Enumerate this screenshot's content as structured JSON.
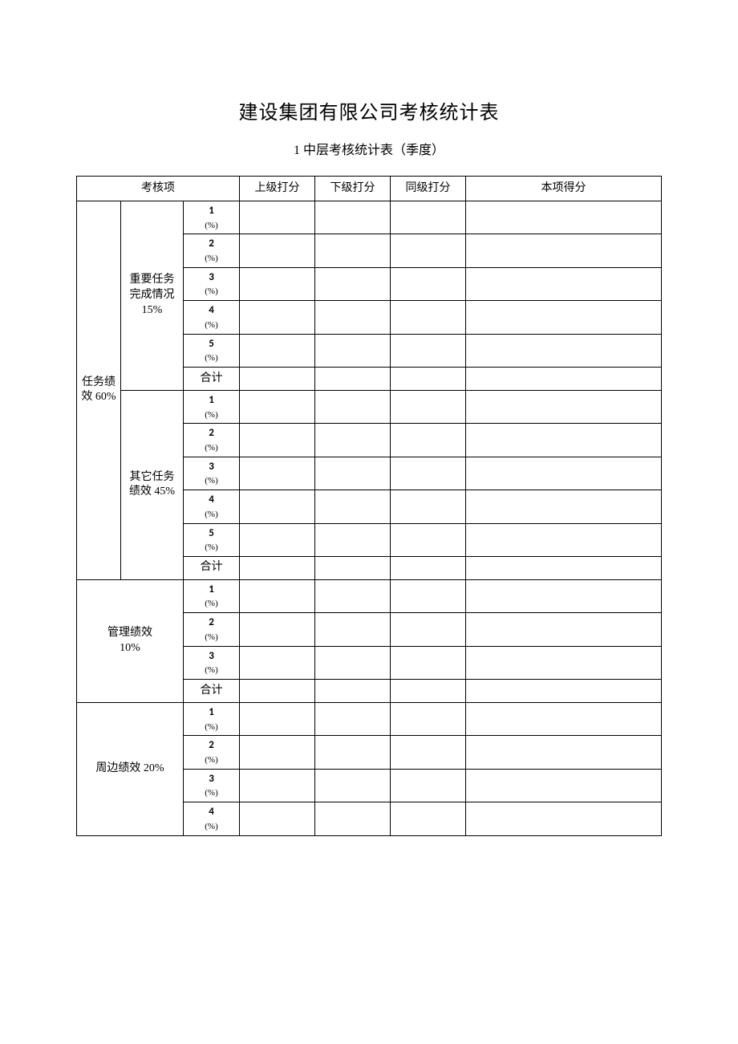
{
  "title": "建设集团有限公司考核统计表",
  "subtitle": "1 中层考核统计表（季度）",
  "headers": {
    "item": "考核项",
    "superior": "上级打分",
    "subordinate": "下级打分",
    "peer": "同级打分",
    "score": "本项得分"
  },
  "labels": {
    "task_perf": "任务绩\n效 60%",
    "important_task": "重要任务\n完成情况\n15%",
    "other_task": "其它任务\n绩效 45%",
    "mgmt_perf": "管理绩效\n10%",
    "peripheral_perf": "周边绩效 20%",
    "subtotal": "合计",
    "n1": "1",
    "n2": "2",
    "n3": "3",
    "n4": "4",
    "n5": "5",
    "pct": "(%)"
  }
}
